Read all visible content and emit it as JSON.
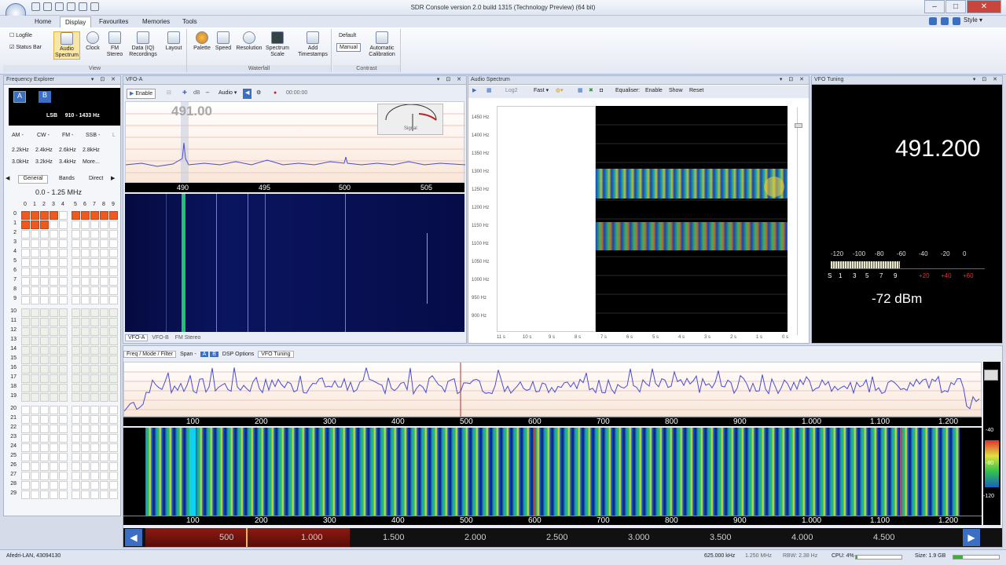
{
  "window": {
    "title": "SDR Console version 2.0 build 1315 (Technology Preview) (64 bit)",
    "style_label": "Style"
  },
  "tabs": [
    "Home",
    "Display",
    "Favourites",
    "Memories",
    "Tools"
  ],
  "ribbon": {
    "view_checks": [
      "Logfile",
      "Status Bar"
    ],
    "view_buttons": [
      "Audio Spectrum",
      "Clock",
      "FM Stereo",
      "Data (IQ) Recordings",
      "Layout"
    ],
    "view_label": "View",
    "waterfall_buttons": [
      "Palette",
      "Speed",
      "Resolution",
      "Spectrum Scale",
      "Add Timestamps"
    ],
    "waterfall_label": "Waterfall",
    "contrast_buttons": [
      "Default",
      "Manual"
    ],
    "contrast_calib": "Automatic Calibration",
    "contrast_label": "Contrast"
  },
  "freq_explorer": {
    "title": "Frequency Explorer",
    "ab": [
      "A",
      "B"
    ],
    "mode_text": "LSB     910 - 1433 Hz",
    "modes": [
      "AM -",
      "CW -",
      "FM -",
      "SSB -",
      "L"
    ],
    "bw_row1": [
      "2.2kHz",
      "2.4kHz",
      "2.6kHz",
      "2.8kHz"
    ],
    "bw_row2": [
      "3.0kHz",
      "3.2kHz",
      "3.4kHz",
      "More..."
    ],
    "tabs": [
      "General",
      "Bands",
      "Direct"
    ],
    "range": "0.0 - 1.25 MHz",
    "cols": [
      "0",
      "1",
      "2",
      "3",
      "4",
      "5",
      "6",
      "7",
      "8",
      "9"
    ],
    "rows": [
      "0",
      "1",
      "2",
      "3",
      "4",
      "5",
      "6",
      "7",
      "8",
      "9",
      "10",
      "11",
      "12",
      "13",
      "14",
      "15",
      "16",
      "17",
      "18",
      "19",
      "20",
      "21",
      "22",
      "23",
      "24",
      "25",
      "26",
      "27",
      "28",
      "29"
    ]
  },
  "vfo": {
    "title": "VFO-A",
    "enable": "Enable",
    "audio": "Audio",
    "time": "00:00:00",
    "freq_big": "491.00",
    "smeter_label": "Signal",
    "axis": [
      "490",
      "495",
      "500",
      "505"
    ],
    "bottom_tabs": [
      "VFO-A",
      "VFO-B",
      "FM Stereo"
    ]
  },
  "audio_spectrum": {
    "title": "Audio Spectrum",
    "log": "Log2",
    "fast": "Fast",
    "equaliser": "Equaliser:",
    "enable": "Enable",
    "show": "Show",
    "reset": "Reset",
    "y_ticks": [
      "1450 Hz",
      "1400 Hz",
      "1350 Hz",
      "1300 Hz",
      "1250 Hz",
      "1200 Hz",
      "1150 Hz",
      "1100 Hz",
      "1050 Hz",
      "1000 Hz",
      "950 Hz",
      "900 Hz"
    ],
    "x_ticks": [
      "11 s",
      "10 s",
      "9 s",
      "8 s",
      "7 s",
      "6 s",
      "5 s",
      "4 s",
      "3 s",
      "2 s",
      "1 s",
      "0 s"
    ]
  },
  "vfo_tuning": {
    "title": "VFO Tuning",
    "freq": "491.200",
    "dbm_scale": [
      "-120",
      "-100",
      "-80",
      "-60",
      "-40",
      "-20",
      "0"
    ],
    "s_scale": [
      "S",
      "1",
      "3",
      "5",
      "7",
      "9",
      "+20",
      "+40",
      "+60"
    ],
    "level": "-72 dBm"
  },
  "main_spectrum": {
    "toolbar": [
      "Freq / Mode / Filter",
      "Span -",
      "A",
      "B",
      "DSP Options",
      "VFO Tuning"
    ],
    "axis": [
      "100",
      "200",
      "300",
      "400",
      "500",
      "600",
      "700",
      "800",
      "900",
      "1.000",
      "1.100",
      "1.200"
    ],
    "side_scale": [
      "-40",
      "-80",
      "-120"
    ],
    "ruler": [
      "500",
      "1.000",
      "1.500",
      "2.000",
      "2.500",
      "3.000",
      "3.500",
      "4.000",
      "4.500"
    ]
  },
  "status": {
    "left": "Afedri-LAN, 43094130",
    "center": "625.000 kHz",
    "span": "1.250 MHz",
    "rbw": "RBW: 2.38 Hz",
    "cpu": "CPU: 4%",
    "size": "Size: 1.9 GB"
  },
  "colors": {
    "accent": "#3a6fc4",
    "grid_on": "#ee5a1e",
    "ribbon_bg": "#e4e9f3",
    "dark_bg": "#000000"
  }
}
